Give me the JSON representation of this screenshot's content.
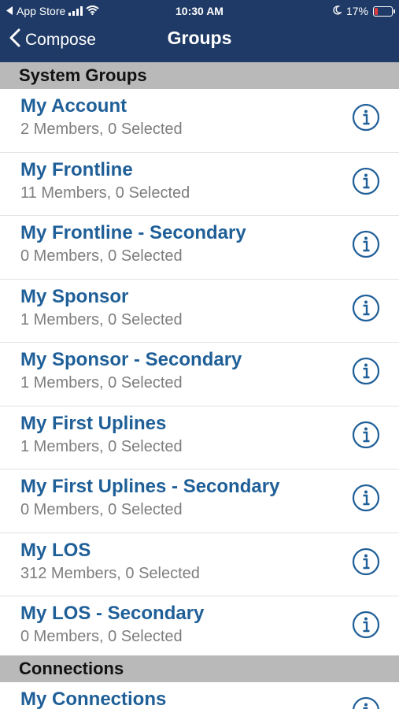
{
  "status_bar": {
    "carrier": "App Store",
    "time": "10:30 AM",
    "battery": "17%"
  },
  "nav": {
    "back_label": "Compose",
    "title": "Groups"
  },
  "sections": [
    {
      "header": "System Groups",
      "items": [
        {
          "title": "My Account",
          "subtitle": "2 Members, 0 Selected"
        },
        {
          "title": "My Frontline",
          "subtitle": "11 Members, 0 Selected"
        },
        {
          "title": "My Frontline - Secondary",
          "subtitle": "0 Members, 0 Selected"
        },
        {
          "title": "My Sponsor",
          "subtitle": "1 Members, 0 Selected"
        },
        {
          "title": "My Sponsor - Secondary",
          "subtitle": "1 Members, 0 Selected"
        },
        {
          "title": "My First Uplines",
          "subtitle": "1 Members, 0 Selected"
        },
        {
          "title": "My First Uplines - Secondary",
          "subtitle": "0 Members, 0 Selected"
        },
        {
          "title": "My LOS",
          "subtitle": "312 Members, 0 Selected"
        },
        {
          "title": "My LOS - Secondary",
          "subtitle": "0 Members, 0 Selected"
        }
      ]
    },
    {
      "header": "Connections",
      "items": [
        {
          "title": "My Connections",
          "subtitle": ""
        }
      ]
    }
  ],
  "icons": {
    "info": "info-circle-icon",
    "back": "chevron-left-icon"
  },
  "colors": {
    "nav_bar": "#1f3a66",
    "title_text": "#1f5f98",
    "subtitle_text": "#7e7e7e",
    "section_header_bg": "#b9b9b9"
  }
}
